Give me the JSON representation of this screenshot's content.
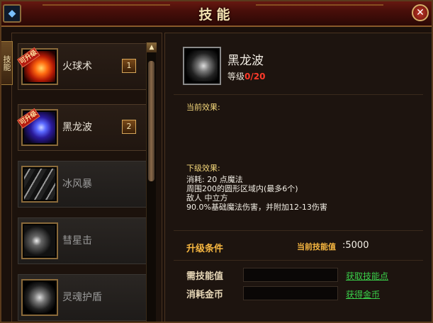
{
  "window": {
    "title": "技能",
    "close_icon": "close-icon",
    "corner_icon": "menu-gem-icon"
  },
  "side_tab": {
    "label": "技能"
  },
  "skills": [
    {
      "name": "火球术",
      "level": "1",
      "badge": "可升级",
      "icon": "fireball-icon",
      "unlocked": true
    },
    {
      "name": "黑龙波",
      "level": "2",
      "badge": "可升级",
      "icon": "black-dragon-wave-icon",
      "unlocked": true
    },
    {
      "name": "冰风暴",
      "level": "",
      "badge": "",
      "icon": "ice-storm-icon",
      "unlocked": false
    },
    {
      "name": "彗星击",
      "level": "",
      "badge": "",
      "icon": "comet-strike-icon",
      "unlocked": false
    },
    {
      "name": "灵魂护盾",
      "level": "",
      "badge": "",
      "icon": "soul-shield-icon",
      "unlocked": false
    }
  ],
  "detail": {
    "name": "黑龙波",
    "level_label": "等级",
    "level_value": "0/20",
    "current_effect_label": "当前效果:",
    "next_effect_label": "下级效果:",
    "next_effect_lines": [
      "消耗: 20 点魔法",
      "周围200的圆形区域内(最多6个)",
      "敌人 中立方",
      "90.0%基础魔法伤害，并附加12-13伤害"
    ],
    "upgrade_title": "升级条件",
    "current_points_label": "当前技能值",
    "current_points_value": ":5000",
    "required_points_label": "需技能值",
    "gold_cost_label": "消耗金币",
    "get_points_link": "获取技能点",
    "get_gold_link": "获得金币"
  },
  "colors": {
    "accent_gold": "#f6b640",
    "link_green": "#3ad04a",
    "level_red": "#ff3a2a"
  }
}
